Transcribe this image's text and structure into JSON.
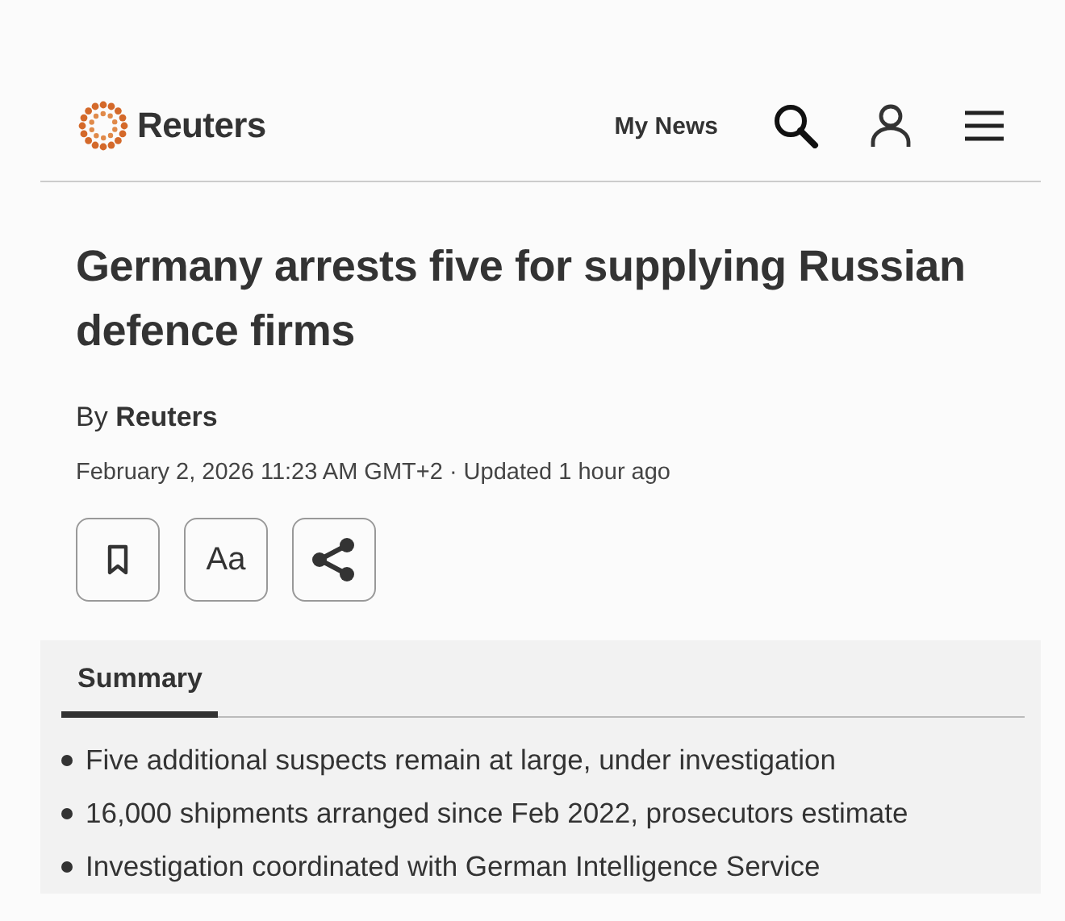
{
  "header": {
    "brand": "Reuters",
    "my_news": "My News"
  },
  "article": {
    "headline": "Germany arrests five for supplying Russian defence firms",
    "byline_prefix": "By",
    "byline_author": "Reuters",
    "dateline": "February 2, 2026 11:23 AM GMT+2 · Updated 1 hour ago",
    "font_button": "Aa"
  },
  "summary": {
    "tabs": [
      {
        "label": "Summary",
        "selected": true
      }
    ],
    "bullets": [
      "Five additional suspects remain at large, under investigation",
      "16,000 shipments arranged since Feb 2022, prosecutors estimate",
      "Investigation coordinated with German Intelligence Service"
    ]
  }
}
